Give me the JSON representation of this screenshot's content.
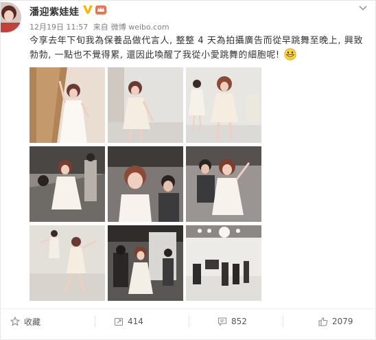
{
  "post": {
    "username": "潘迎紫娃娃",
    "date": "12月19日 11:57",
    "source_prefix": "来自",
    "source": "微博 weibo.com",
    "text": "今享去年下旬我為保養品做代言人, 整整 4 天為拍攝廣告而從早跳舞至晚上, 興致勃勃, 一點也不覺得累, 還因此喚醒了我從小愛跳舞的細胞呢!"
  },
  "icons": {
    "verified": "vip-v-icon",
    "member": "member-crown-icon",
    "menu": "chevron-down-icon",
    "emoji": "grin-emoji-icon",
    "favorite": "star-icon",
    "repost": "repost-icon",
    "comment": "comment-icon",
    "like": "thumbs-up-icon"
  },
  "photos": [
    {
      "label": "dancer in white dress near wooden door"
    },
    {
      "label": "dancer twirling in studio"
    },
    {
      "label": "two dancers in white dresses"
    },
    {
      "label": "dancer in studio with crew"
    },
    {
      "label": "close-up smiling dancer with crew"
    },
    {
      "label": "dancer with crew member"
    },
    {
      "label": "dancer on white stage arms raised"
    },
    {
      "label": "dancer on set with cameraman"
    },
    {
      "label": "film crew on white studio set"
    }
  ],
  "actions": {
    "favorite_label": "收藏",
    "repost_count": "414",
    "comment_count": "852",
    "like_count": "2079"
  },
  "colors": {
    "brand_orange": "#eb7350",
    "vip_gold": "#f7b500",
    "text_main": "#333333",
    "text_meta": "#808080"
  }
}
